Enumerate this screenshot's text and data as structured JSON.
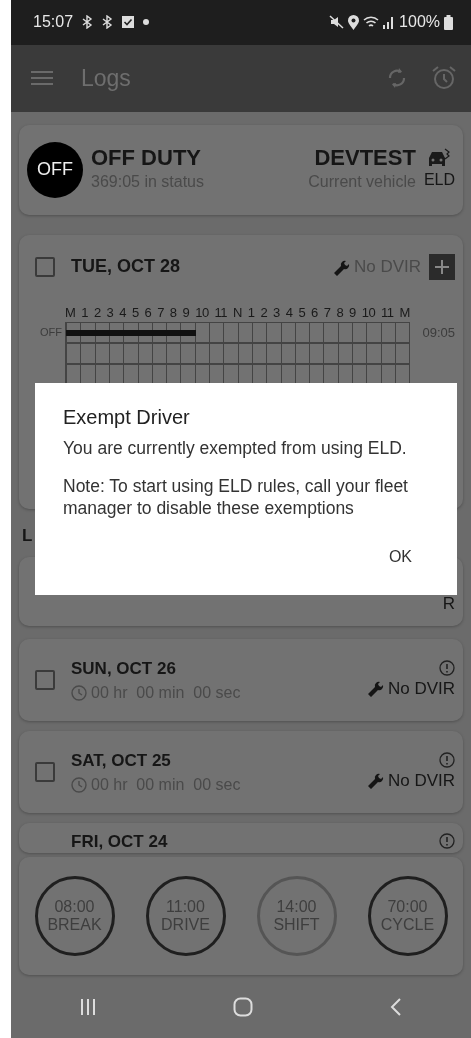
{
  "status_bar": {
    "time": "15:07",
    "battery": "100%"
  },
  "app_bar": {
    "title": "Logs"
  },
  "status_card": {
    "badge": "OFF",
    "status": "OFF DUTY",
    "duration": "369:05 in status",
    "vehicle": "DEVTEST",
    "vehicle_caption": "Current vehicle",
    "eld_label": "ELD"
  },
  "current_day": {
    "date": "TUE, OCT 28",
    "checked": false,
    "dvir": "No DVIR",
    "hour_labels": [
      "M",
      "1",
      "2",
      "3",
      "4",
      "5",
      "6",
      "7",
      "8",
      "9",
      "10",
      "11",
      "N",
      "1",
      "2",
      "3",
      "4",
      "5",
      "6",
      "7",
      "8",
      "9",
      "10",
      "11",
      "M"
    ],
    "rows": [
      {
        "label": "OFF",
        "total": "09:05",
        "level": 0.378
      }
    ]
  },
  "section_heading": "L",
  "covered_card": {
    "dvir_fragment": "R"
  },
  "days": [
    {
      "date": "SUN, OCT 26",
      "checked": false,
      "duration": "00 hr  00 min  00 sec",
      "dvir": "No DVIR"
    },
    {
      "date": "SAT, OCT 25",
      "checked": false,
      "duration": "00 hr  00 min  00 sec",
      "dvir": "No DVIR"
    },
    {
      "date": "FRI, OCT 24"
    }
  ],
  "timers": [
    {
      "time": "08:00",
      "label": "BREAK",
      "active": true
    },
    {
      "time": "11:00",
      "label": "DRIVE",
      "active": true
    },
    {
      "time": "14:00",
      "label": "SHIFT",
      "active": false
    },
    {
      "time": "70:00",
      "label": "CYCLE",
      "active": true
    }
  ],
  "dialog": {
    "title": "Exempt Driver",
    "paragraphs": [
      "You are currently exempted from using ELD.",
      "Note: To start using ELD rules, call your fleet manager to disable these exemptions"
    ],
    "button": "OK"
  }
}
